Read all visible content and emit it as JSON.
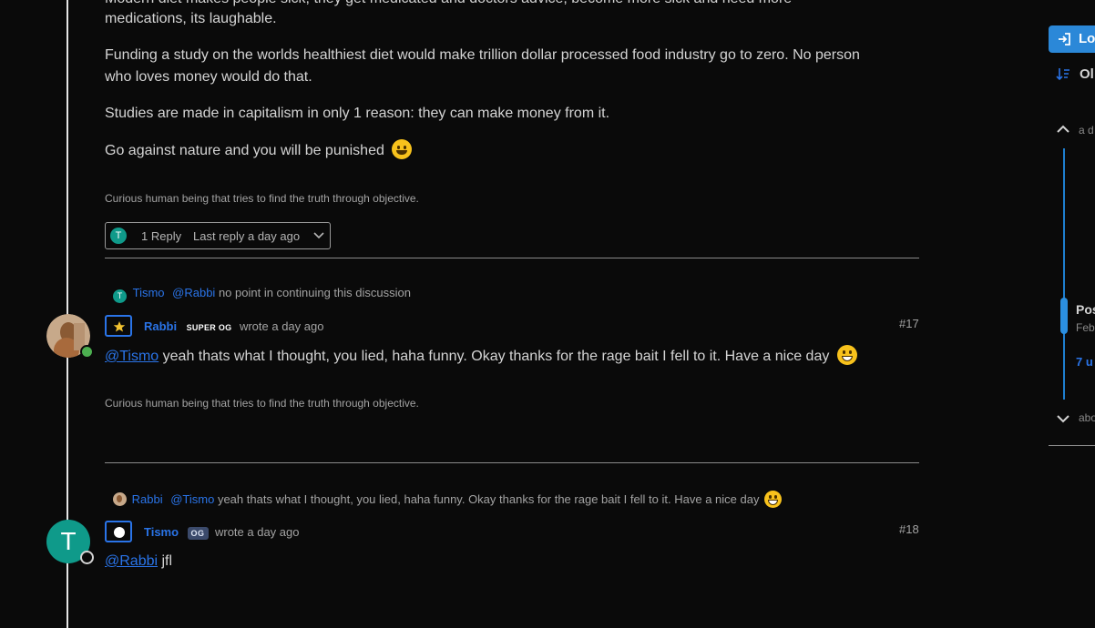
{
  "post16": {
    "partial_line": "Modern diet makes people sick, they get medicated and doctors advice, become more sick and need more",
    "line_cont": "medications, its laughable.",
    "para2_line1": "Funding a study on the worlds healthiest diet would make trillion dollar processed food industry go to zero. No person",
    "para2_line2": "who loves money would do that.",
    "para3": "Studies are made in capitalism in only 1 reason: they can make money from it.",
    "para4": "Go against nature and you will be punished",
    "signature": "Curious human being that tries to find the truth through objective.",
    "replies": {
      "avatar_letter": "T",
      "count_label": "1 Reply",
      "last_reply_label": "Last reply a day ago"
    }
  },
  "post17": {
    "parent": {
      "avatar_letter": "T",
      "author": "Tismo",
      "mention": "@Rabbi",
      "text": "no point in continuing this discussion"
    },
    "author": "Rabbi",
    "badge": "SUPER OG",
    "meta": "wrote a day ago",
    "number": "#17",
    "mention": "@Tismo",
    "content": "yeah thats what I thought, you lied, haha funny. Okay thanks for the rage bait I fell to it. Have a nice day",
    "signature": "Curious human being that tries to find the truth through objective.",
    "status_color": "#4caf50"
  },
  "post18": {
    "parent": {
      "author": "Rabbi",
      "mention": "@Tismo",
      "text": "yeah thats what I thought, you lied, haha funny. Okay thanks for the rage bait I fell to it. Have a nice day"
    },
    "avatar_letter": "T",
    "author": "Tismo",
    "badge": "OG",
    "meta": "wrote a day ago",
    "number": "#18",
    "mention": "@Rabbi",
    "content": "jfl"
  },
  "sidebar": {
    "login_label": "Lo",
    "sort_label": "Ol",
    "up_label": "a d",
    "post_label": "Pos",
    "date_label": "Feb",
    "unread_label": "7 u",
    "down_label": "abo"
  },
  "colors": {
    "accent": "#2a74e8",
    "teal_avatar": "#0f9a8a",
    "primary_button": "#2b88d8"
  }
}
